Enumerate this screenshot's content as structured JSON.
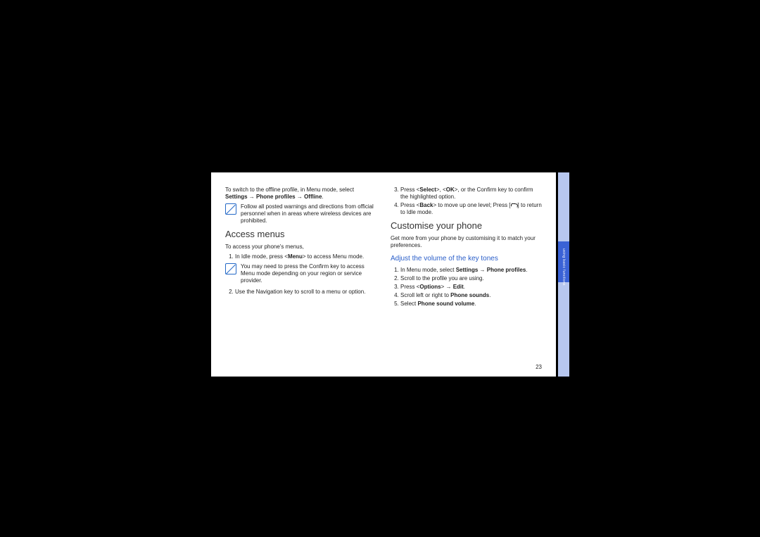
{
  "left": {
    "intro_prefix": "To switch to the offline profile, in Menu mode, select ",
    "intro_b1": "Settings",
    "arrow": " → ",
    "intro_b2": "Phone profiles",
    "intro_b3": "Offline",
    "note1": "Follow all posted warnings and directions from official personnel when in areas where wireless devices are prohibited.",
    "h1": "Access menus",
    "sub": "To access your phone's menus,",
    "step1a": "In Idle mode, press <",
    "step1b": "Menu",
    "step1c": "> to access Menu mode.",
    "note2": "You may need to press the Confirm key to access Menu mode depending on your region or service provider.",
    "step2": "Use the Navigation key to scroll to a menu or option."
  },
  "right": {
    "step3a": "Press <",
    "step3b": "Select",
    "step3c": ">, <",
    "step3d": "OK",
    "step3e": ">, or the Confirm key to confirm the highlighted option.",
    "step4a": "Press <",
    "step4b": "Back",
    "step4c": "> to move up one level; Press [",
    "step4d": "] to return to Idle mode.",
    "h1": "Customise your phone",
    "sub": "Get more from your phone by customising it to match your preferences.",
    "h2": "Adjust the volume of the key tones",
    "r1a": "In Menu mode, select ",
    "r1b": "Settings",
    "r1c": "Phone profiles",
    "r2": "Scroll to the profile you are using.",
    "r3a": "Press <",
    "r3b": "Options",
    "r3c": "> → ",
    "r3d": "Edit",
    "r4a": "Scroll left or right to ",
    "r4b": "Phone sounds",
    "r5a": "Select ",
    "r5b": "Phone sound volume"
  },
  "pageNumber": "23",
  "tabLabel": "using basic functions",
  "noteIconGlyph": "✎"
}
